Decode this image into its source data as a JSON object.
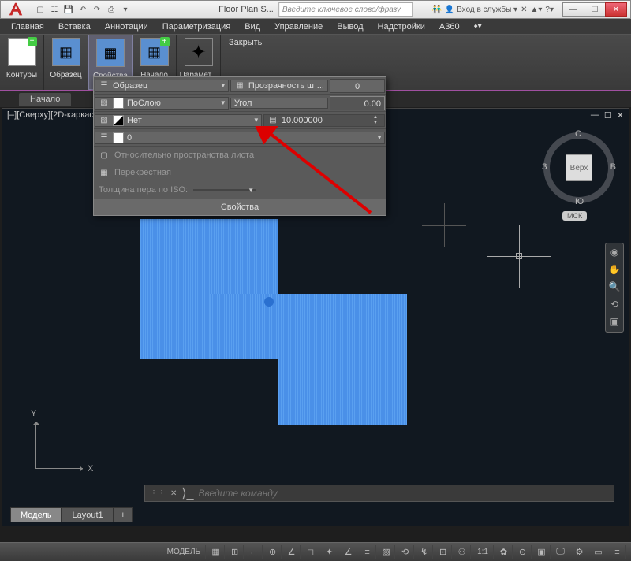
{
  "window": {
    "doc_title": "Floor Plan S...",
    "search_placeholder": "Введите ключевое слово/фразу",
    "login": "Вход в службы"
  },
  "menu": [
    "Главная",
    "Вставка",
    "Аннотации",
    "Параметризация",
    "Вид",
    "Управление",
    "Вывод",
    "Надстройки",
    "A360"
  ],
  "ribbon": {
    "panes": [
      {
        "label": "Контуры",
        "icon": "plus"
      },
      {
        "label": "Образец",
        "icon": "pattern"
      },
      {
        "label": "Свойства",
        "icon": "pattern",
        "active": true
      },
      {
        "label": "Начало",
        "icon": "plus"
      },
      {
        "label": "Парамет...",
        "icon": "spark"
      }
    ],
    "close": "Закрыть"
  },
  "start_tab": "Начало",
  "doc": {
    "title": "[–][Сверху][2D-каркас"
  },
  "viewcube": {
    "face": "Верх",
    "n": "С",
    "s": "Ю",
    "e": "В",
    "w": "З",
    "wcs": "МСК"
  },
  "axis": {
    "x": "X",
    "y": "Y"
  },
  "props": {
    "pattern": "Образец",
    "bylayer": "ПоСлою",
    "none": "Нет",
    "zero": "0",
    "transparency_label": "Прозрачность шт...",
    "transparency_val": "0",
    "angle_label": "Угол",
    "angle_val": "0.00",
    "scale_val": "10.000000",
    "rel_paper": "Относительно пространства листа",
    "cross": "Перекрестная",
    "iso_pen": "Толщина пера по ISO:",
    "footer": "Свойства"
  },
  "cmd": {
    "placeholder": "Введите команду"
  },
  "tabs": {
    "model": "Модель",
    "layout": "Layout1"
  },
  "status": {
    "model": "МОДЕЛЬ",
    "scale": "1:1"
  }
}
